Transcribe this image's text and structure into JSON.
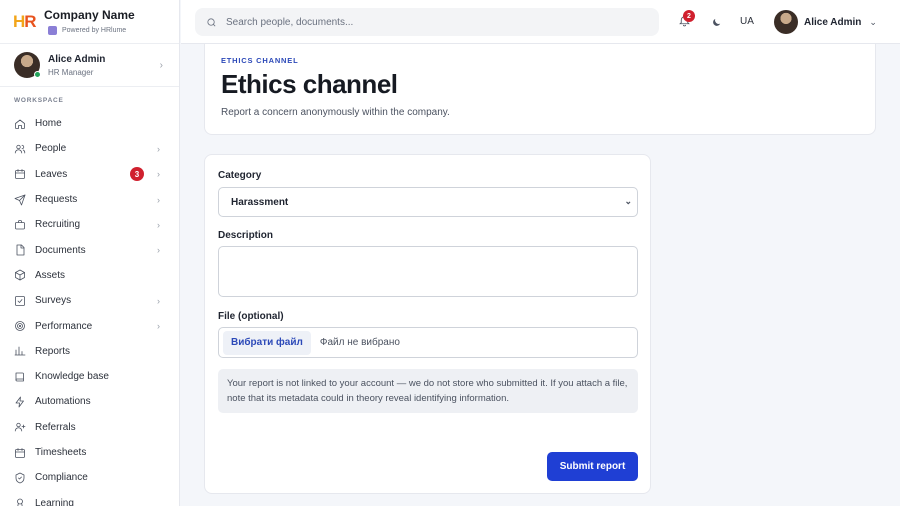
{
  "brand": {
    "name": "Company Name",
    "powered_by": "Powered by HRlume",
    "logo_h": "H",
    "logo_r": "R"
  },
  "user_card": {
    "name": "Alice Admin",
    "role": "HR Manager"
  },
  "sidebar": {
    "section_label": "WORKSPACE",
    "items": [
      {
        "label": "Home",
        "icon": "home-icon",
        "chevron": false
      },
      {
        "label": "People",
        "icon": "users-icon",
        "chevron": true
      },
      {
        "label": "Leaves",
        "icon": "calendar-icon",
        "chevron": true,
        "badge": "3"
      },
      {
        "label": "Requests",
        "icon": "send-icon",
        "chevron": true
      },
      {
        "label": "Recruiting",
        "icon": "briefcase-icon",
        "chevron": true
      },
      {
        "label": "Documents",
        "icon": "file-icon",
        "chevron": true
      },
      {
        "label": "Assets",
        "icon": "box-icon",
        "chevron": false
      },
      {
        "label": "Surveys",
        "icon": "checkbox-icon",
        "chevron": true
      },
      {
        "label": "Performance",
        "icon": "target-icon",
        "chevron": true
      },
      {
        "label": "Reports",
        "icon": "bar-chart-icon",
        "chevron": false
      },
      {
        "label": "Knowledge base",
        "icon": "book-icon",
        "chevron": false
      },
      {
        "label": "Automations",
        "icon": "bolt-icon",
        "chevron": false
      },
      {
        "label": "Referrals",
        "icon": "user-plus-icon",
        "chevron": false
      },
      {
        "label": "Timesheets",
        "icon": "calendar-icon",
        "chevron": false
      },
      {
        "label": "Compliance",
        "icon": "shield-icon",
        "chevron": false
      },
      {
        "label": "Learning",
        "icon": "award-icon",
        "chevron": false
      }
    ]
  },
  "topbar": {
    "search_placeholder": "Search people, documents...",
    "notifications_count": "2",
    "language": "UA",
    "user_name": "Alice Admin"
  },
  "page": {
    "eyebrow": "ETHICS CHANNEL",
    "title": "Ethics channel",
    "subtitle": "Report a concern anonymously within the company."
  },
  "form": {
    "category_label": "Category",
    "category_value": "Harassment",
    "description_label": "Description",
    "description_value": "",
    "file_label": "File (optional)",
    "file_button": "Вибрати файл",
    "file_status": "Файл не вибрано",
    "note": "Your report is not linked to your account — we do not store who submitted it. If you attach a file, note that its metadata could in theory reveal identifying information.",
    "submit_label": "Submit report"
  },
  "colors": {
    "accent": "#1f3fd4",
    "badge": "#d0202e",
    "eyebrow": "#2c49b8"
  }
}
